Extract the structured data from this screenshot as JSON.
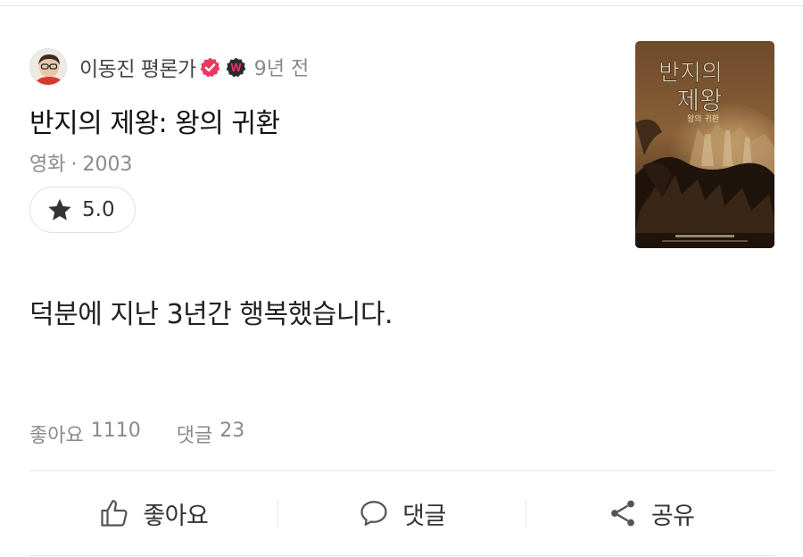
{
  "author": {
    "name": "이동진 평론가",
    "time_ago": "9년 전",
    "verified_icon": "verified-check-icon",
    "badge_icon": "watcha-w-badge-icon",
    "badge_letter": "W"
  },
  "movie": {
    "title": "반지의 제왕: 왕의 귀환",
    "category": "영화",
    "year": "2003",
    "poster": {
      "title_line1": "반지의",
      "title_line2": "제왕",
      "subtitle": "왕의 귀환"
    }
  },
  "rating": {
    "icon": "star-icon",
    "value": "5.0"
  },
  "review": {
    "text": "덕분에 지난 3년간 행복했습니다."
  },
  "stats": {
    "likes_label": "좋아요",
    "likes_count": "1110",
    "comments_label": "댓글",
    "comments_count": "23"
  },
  "actions": {
    "like_label": "좋아요",
    "comment_label": "댓글",
    "share_label": "공유"
  },
  "colors": {
    "verified": "#e83a5f",
    "badge_w": "#2b2b2b",
    "text_primary": "#222222",
    "text_secondary": "#8a8a8a",
    "divider": "#e6e6e6"
  }
}
